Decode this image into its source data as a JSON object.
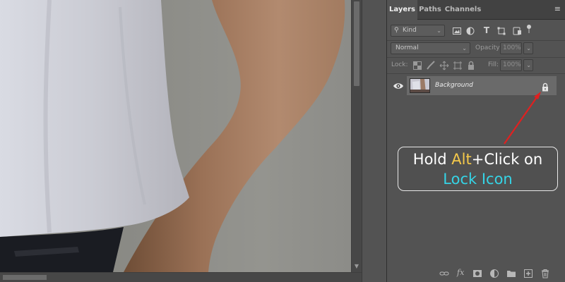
{
  "layers_panel": {
    "tabs": [
      {
        "label": "Layers",
        "active": true
      },
      {
        "label": "Paths",
        "active": false
      },
      {
        "label": "Channels",
        "active": false
      }
    ],
    "filter": {
      "kind_label": "Kind"
    },
    "blend_mode": "Normal",
    "opacity": {
      "label": "Opacity:",
      "value": "100%"
    },
    "lock_label": "Lock:",
    "fill": {
      "label": "Fill:",
      "value": "100%"
    },
    "layers": [
      {
        "name": "Background",
        "visible": true,
        "locked": true
      }
    ]
  },
  "callout": {
    "part1": "Hold ",
    "alt": "Alt",
    "part2": "+Click on",
    "line2": "Lock Icon",
    "colors": {
      "alt": "#f4c84a",
      "lock_icon": "#35d4e6",
      "arrow": "#e02020"
    }
  },
  "icons": {
    "panel_menu": "panel-menu-icon",
    "search": "search-icon",
    "footer": [
      "link-icon",
      "fx-icon",
      "mask-icon",
      "adjustment-icon",
      "folder-icon",
      "new-layer-icon",
      "trash-icon"
    ]
  }
}
